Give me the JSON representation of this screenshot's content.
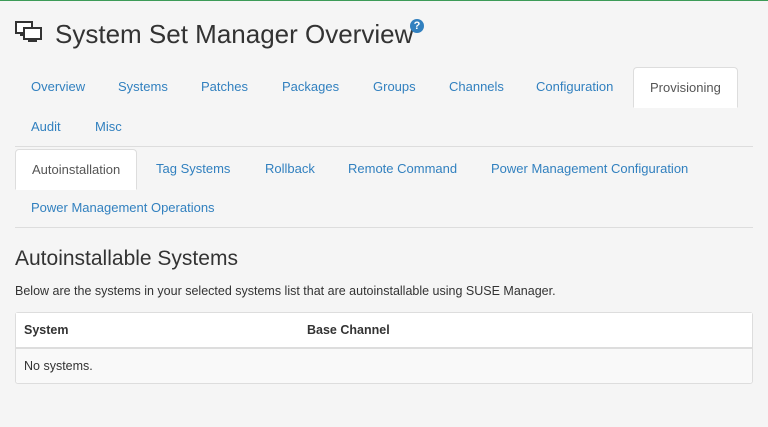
{
  "header": {
    "title": "System Set Manager Overview",
    "help_glyph": "?"
  },
  "tabs": [
    {
      "label": "Overview"
    },
    {
      "label": "Systems"
    },
    {
      "label": "Patches"
    },
    {
      "label": "Packages"
    },
    {
      "label": "Groups"
    },
    {
      "label": "Channels"
    },
    {
      "label": "Configuration"
    },
    {
      "label": "Provisioning",
      "active": true
    },
    {
      "label": "Audit"
    },
    {
      "label": "Misc"
    }
  ],
  "subtabs": [
    {
      "label": "Autoinstallation",
      "active": true
    },
    {
      "label": "Tag Systems"
    },
    {
      "label": "Rollback"
    },
    {
      "label": "Remote Command"
    },
    {
      "label": "Power Management Configuration"
    },
    {
      "label": "Power Management Operations"
    }
  ],
  "section": {
    "title": "Autoinstallable Systems",
    "description": "Below are the systems in your selected systems list that are autoinstallable using SUSE Manager."
  },
  "table": {
    "columns": [
      "System",
      "Base Channel"
    ],
    "empty_message": "No systems."
  },
  "colors": {
    "link": "#3180bf",
    "top_border": "#3c9b57",
    "background": "#f5f5f5"
  },
  "icons": {
    "header": "system-group-icon",
    "help": "help-icon"
  }
}
